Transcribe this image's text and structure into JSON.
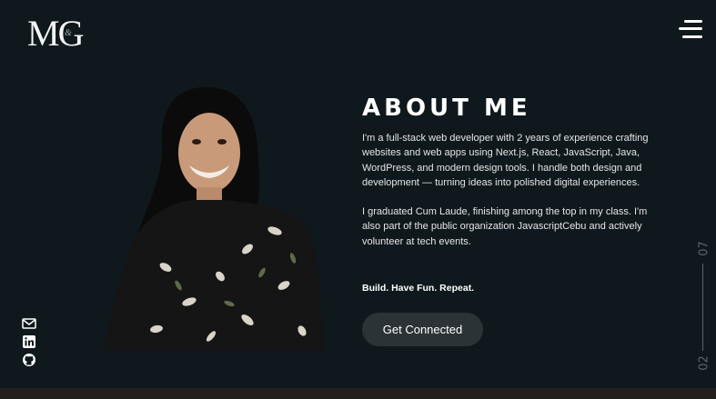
{
  "header": {
    "logo_text": "MG",
    "logo_accent": "&",
    "menu_icon": "hamburger-menu-icon"
  },
  "about": {
    "title": "ABOUT ME",
    "paragraph_1": "I'm a full-stack web developer with 2 years of experience crafting websites and web apps using Next.js, React, JavaScript, Java, WordPress, and modern design tools. I handle both design and development — turning ideas into polished digital experiences.",
    "paragraph_2": "I graduated Cum Laude, finishing among the top in my class. I'm also part of the public organization JavascriptCebu and actively volunteer at tech events.",
    "tagline": "Build. Have Fun. Repeat.",
    "cta_label": "Get Connected"
  },
  "socials": {
    "items": [
      {
        "icon": "mail-icon"
      },
      {
        "icon": "linkedin-icon"
      },
      {
        "icon": "github-icon"
      }
    ]
  },
  "pager": {
    "current": "02",
    "total": "07"
  },
  "colors": {
    "background": "#0f181d",
    "button": "#2b3337",
    "muted": "#5c666b"
  }
}
